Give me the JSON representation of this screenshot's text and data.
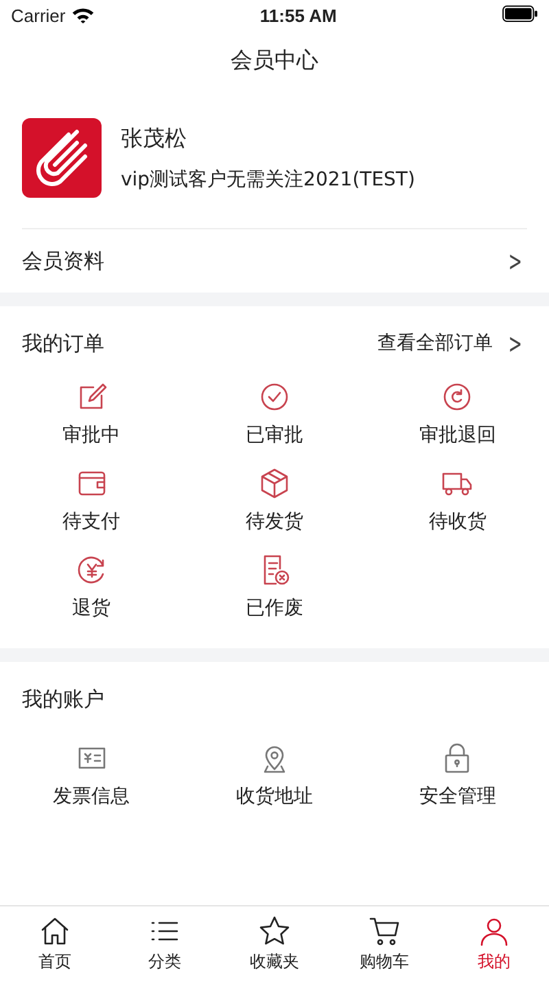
{
  "status_bar": {
    "carrier": "Carrier",
    "time": "11:55 AM"
  },
  "nav": {
    "title": "会员中心"
  },
  "profile": {
    "name": "张茂松",
    "subtitle": "vip测试客户无需关注2021(TEST)"
  },
  "member_link": {
    "label": "会员资料",
    "chevron": ">"
  },
  "orders": {
    "title": "我的订单",
    "view_all": "查看全部订单",
    "chevron": ">",
    "items": [
      {
        "kind": "edit",
        "label": "审批中"
      },
      {
        "kind": "check",
        "label": "已审批"
      },
      {
        "kind": "return",
        "label": "审批退回"
      },
      {
        "kind": "wallet",
        "label": "待支付"
      },
      {
        "kind": "box",
        "label": "待发货"
      },
      {
        "kind": "truck",
        "label": "待收货"
      },
      {
        "kind": "refund",
        "label": "退货"
      },
      {
        "kind": "void",
        "label": "已作废"
      }
    ]
  },
  "account": {
    "title": "我的账户",
    "items": [
      {
        "kind": "invoice",
        "label": "发票信息"
      },
      {
        "kind": "pin",
        "label": "收货地址"
      },
      {
        "kind": "lock",
        "label": "安全管理"
      }
    ]
  },
  "tab_bar": [
    {
      "kind": "home",
      "label": "首页",
      "selected": false
    },
    {
      "kind": "list",
      "label": "分类",
      "selected": false
    },
    {
      "kind": "star",
      "label": "收藏夹",
      "selected": false
    },
    {
      "kind": "cart",
      "label": "购物车",
      "selected": false
    },
    {
      "kind": "person",
      "label": "我的",
      "selected": true
    }
  ]
}
